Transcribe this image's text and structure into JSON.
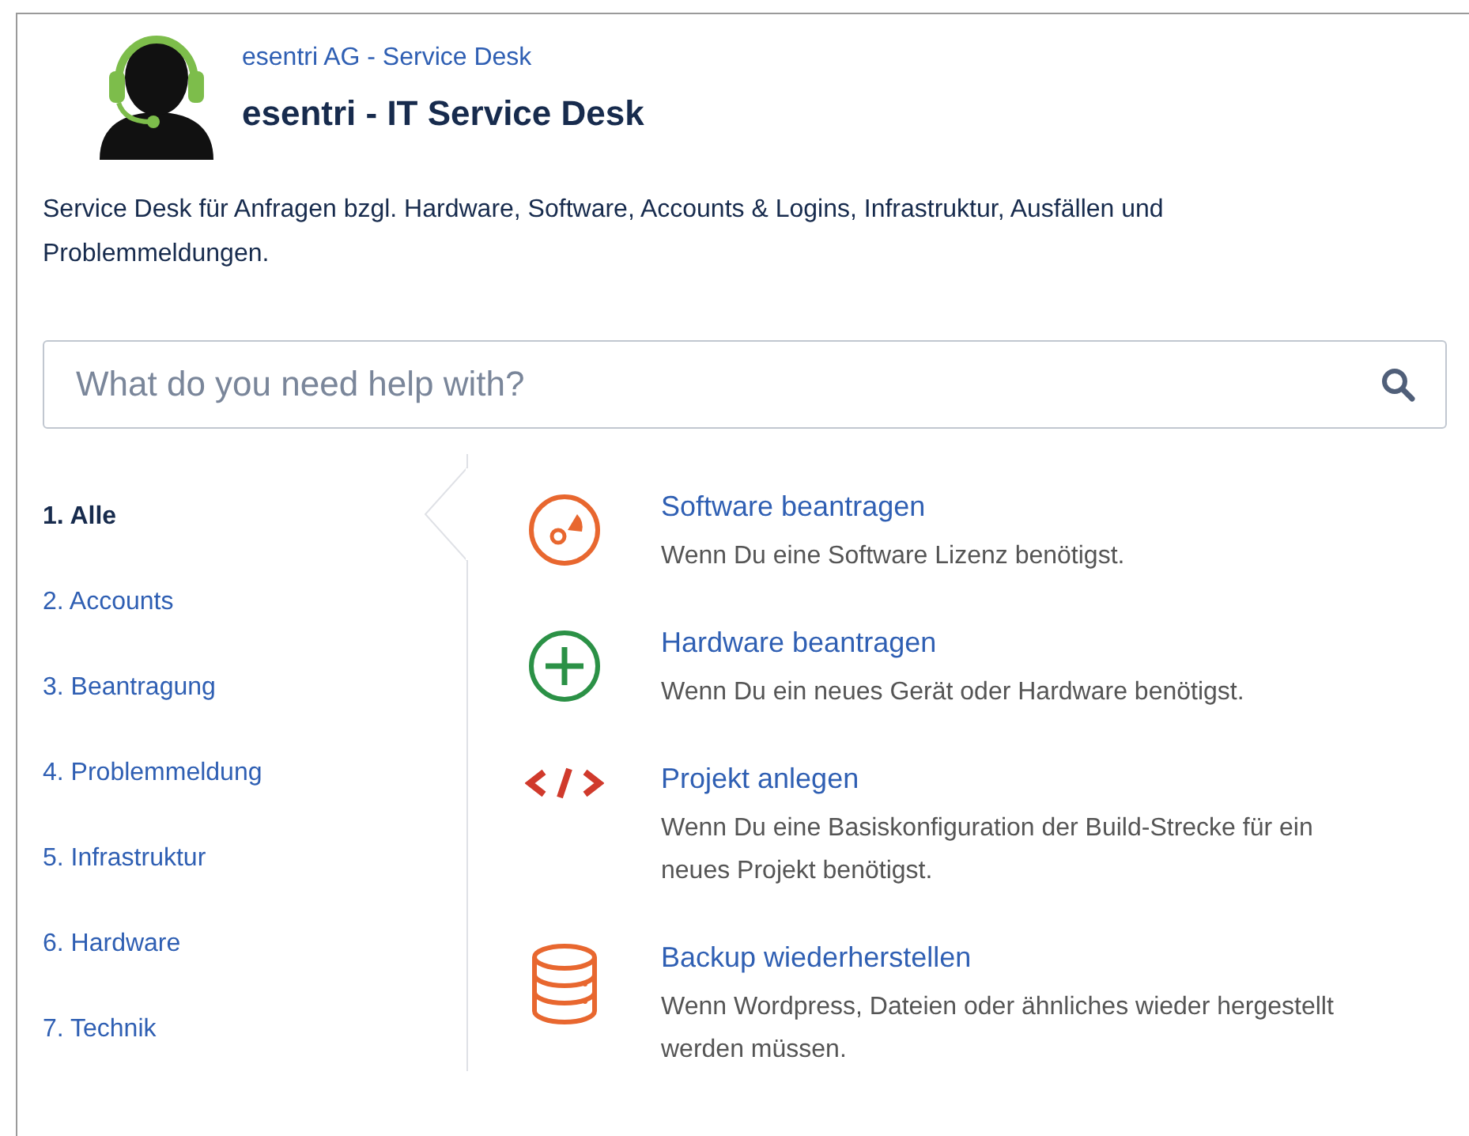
{
  "header": {
    "portal_link": "esentri AG - Service Desk",
    "title": "esentri - IT Service Desk"
  },
  "description": "Service Desk für Anfragen bzgl. Hardware, Software, Accounts & Logins, Infrastruktur, Ausfällen und Problemmeldungen.",
  "search": {
    "placeholder": "What do you need help with?"
  },
  "sidebar": {
    "items": [
      {
        "label": "1. Alle",
        "selected": true
      },
      {
        "label": "2. Accounts",
        "selected": false
      },
      {
        "label": "3. Beantragung",
        "selected": false
      },
      {
        "label": "4. Problemmeldung",
        "selected": false
      },
      {
        "label": "5. Infrastruktur",
        "selected": false
      },
      {
        "label": "6. Hardware",
        "selected": false
      },
      {
        "label": "7. Technik",
        "selected": false
      }
    ]
  },
  "request_types": [
    {
      "kind": "disc",
      "title": "Software beantragen",
      "description": "Wenn Du eine Software Lizenz benötigst."
    },
    {
      "kind": "plus",
      "title": "Hardware beantragen",
      "description": "Wenn Du ein neues Gerät oder Hardware benötigst."
    },
    {
      "kind": "code",
      "title": "Projekt anlegen",
      "description": "Wenn Du eine Basiskonfiguration der Build-Strecke für ein neues Projekt benötigst."
    },
    {
      "kind": "database",
      "title": "Backup wiederherstellen",
      "description": "Wenn Wordpress, Dateien oder ähnliches wieder hergestellt werden müssen."
    }
  ]
}
